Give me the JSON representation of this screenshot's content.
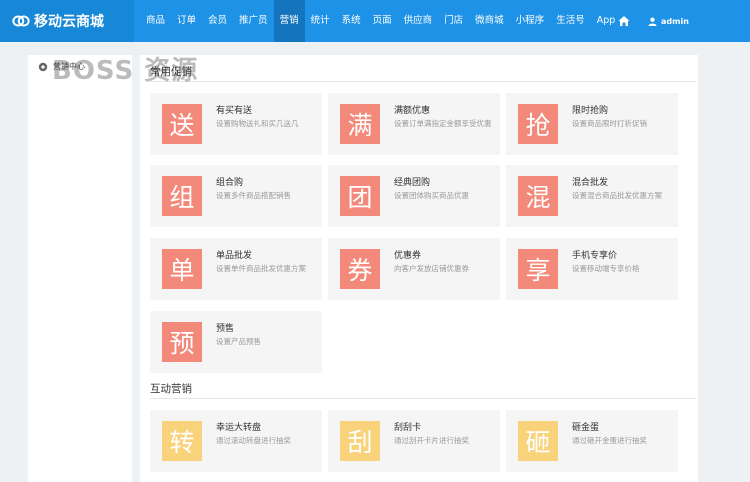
{
  "header": {
    "brand": "移动云商城",
    "nav": [
      "商品",
      "订单",
      "会员",
      "推广员",
      "营销",
      "统计",
      "系统",
      "页面",
      "供应商",
      "门店",
      "微商城",
      "小程序",
      "生活号",
      "App"
    ],
    "active_index": 4,
    "user": "admin"
  },
  "sidebar": {
    "item": "营销中心"
  },
  "watermark": "BOSS 资源",
  "sections": [
    {
      "title": "常用促销",
      "cards": [
        {
          "glyph": "送",
          "title": "有买有送",
          "desc": "设置购物送礼和买几送几",
          "color": "red"
        },
        {
          "glyph": "满",
          "title": "满额优惠",
          "desc": "设置订单满指定金额享受优惠",
          "color": "red"
        },
        {
          "glyph": "抢",
          "title": "限时抢购",
          "desc": "设置商品限时打折促销",
          "color": "red"
        },
        {
          "glyph": "组",
          "title": "组合购",
          "desc": "设置多件商品搭配销售",
          "color": "red"
        },
        {
          "glyph": "团",
          "title": "经典团购",
          "desc": "设置团体购买商品优惠",
          "color": "red"
        },
        {
          "glyph": "混",
          "title": "混合批发",
          "desc": "设置混合商品批发优惠方案",
          "color": "red"
        },
        {
          "glyph": "单",
          "title": "单品批发",
          "desc": "设置单件商品批发优惠方案",
          "color": "red"
        },
        {
          "glyph": "券",
          "title": "优惠券",
          "desc": "向客户发放店铺优惠券",
          "color": "red"
        },
        {
          "glyph": "享",
          "title": "手机专享价",
          "desc": "设置移动端专享价格",
          "color": "red"
        },
        {
          "glyph": "预",
          "title": "预售",
          "desc": "设置产品预售",
          "color": "red"
        }
      ]
    },
    {
      "title": "互动营销",
      "cards": [
        {
          "glyph": "转",
          "title": "幸运大转盘",
          "desc": "通过滚动转盘进行抽奖",
          "color": "yellow"
        },
        {
          "glyph": "刮",
          "title": "刮刮卡",
          "desc": "通过刮开卡片进行抽奖",
          "color": "yellow"
        },
        {
          "glyph": "砸",
          "title": "砸金蛋",
          "desc": "通过砸开金蛋进行抽奖",
          "color": "yellow"
        }
      ]
    }
  ]
}
